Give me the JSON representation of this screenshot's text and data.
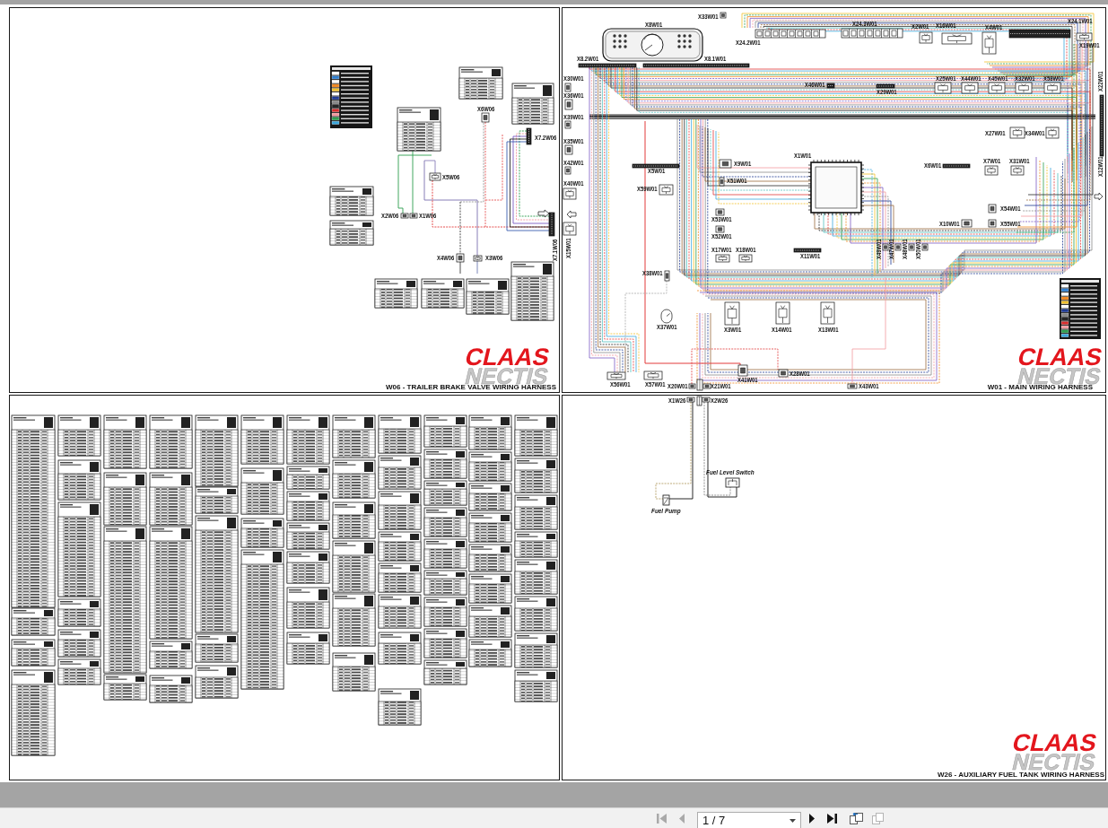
{
  "panels": [
    {
      "kind": "trailer_brake",
      "connectors": [
        "X6W06",
        "X7.2W06",
        "X5W06",
        "X2W06",
        "X1W06",
        "X4W06",
        "X3W06",
        "X7.1W06"
      ],
      "logo": {
        "brand": "CLAAS",
        "model": "NECTIS"
      },
      "title": "W06 - TRAILER BRAKE VALVE WIRING HARNESS"
    },
    {
      "kind": "main",
      "connectors": [
        "X33W01",
        "X8W01",
        "X24.2W01",
        "X24.3W01",
        "X2W01",
        "X16W01",
        "X4W01",
        "X24.1W01",
        "X19W01",
        "X8.2W01",
        "X8.1W01",
        "X30W01",
        "X46W01",
        "X25W01",
        "X44W01",
        "X45W01",
        "X32W01",
        "X58W01",
        "X36W01",
        "X29W01",
        "X39W01",
        "X22W01",
        "X27W01",
        "X34W01",
        "X35W01",
        "X5W01",
        "X9W01",
        "X1W01",
        "X6W01",
        "X7W01",
        "X31W01",
        "X42W01",
        "X51W01",
        "X59W01",
        "X12W01",
        "X40W01",
        "X54W01",
        "X53W01",
        "X10W01",
        "X55W01",
        "X52W01",
        "X15W01",
        "X49W01",
        "X47W01",
        "X48W01",
        "X50W01",
        "X17W01",
        "X18W01",
        "X11W01",
        "X38W01",
        "X37W01",
        "X3W01",
        "X14W01",
        "X13W01",
        "X28W01",
        "X41W01",
        "X56W01",
        "X57W01",
        "X20W01",
        "X21W01",
        "X43W01"
      ],
      "logo": {
        "brand": "CLAAS",
        "model": "NECTIS"
      },
      "title": "W01 - MAIN WIRING HARNESS"
    },
    {
      "kind": "connector_tables"
    },
    {
      "kind": "aux_fuel",
      "connectors": [
        "X1W26",
        "X2W26"
      ],
      "components": [
        "Fuel Level Switch",
        "Fuel Pump"
      ],
      "logo": {
        "brand": "CLAAS",
        "model": "NECTIS"
      },
      "title": "W26 - AUXILIARY FUEL TANK WIRING HARNESS"
    }
  ],
  "toolbar": {
    "nav_back": [
      {
        "kind": "first",
        "disabled": true
      },
      {
        "kind": "previous",
        "disabled": true
      }
    ],
    "page_field": {
      "value": "1 / 7"
    },
    "nav_forward": [
      {
        "kind": "next",
        "disabled": false
      },
      {
        "kind": "last",
        "disabled": false
      }
    ],
    "tools": [
      {
        "kind": "rotate",
        "disabled": false
      },
      {
        "kind": "fit",
        "disabled": true
      }
    ]
  }
}
